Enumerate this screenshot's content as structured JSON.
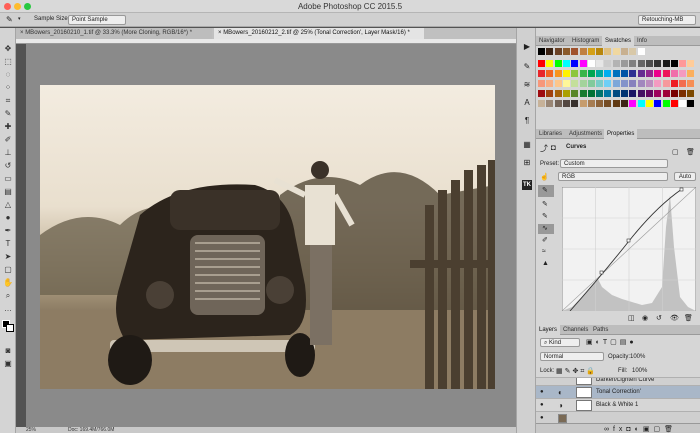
{
  "window": {
    "title": "Adobe Photoshop CC 2015.5"
  },
  "options_bar": {
    "sample_size_label": "Sample Size:",
    "sample_size_value": "Point Sample",
    "workspace": "Retouching-MB"
  },
  "documents": [
    {
      "label": "MBowers_20160210_1.tif @ 33.3% (More Cloning, RGB/16*) *",
      "active": false
    },
    {
      "label": "MBowers_20160212_2.tif @ 25% (Tonal Correction', Layer Mask/16) *",
      "active": true
    }
  ],
  "status_bar": {
    "zoom": "25%",
    "doc": "Doc: 169.4M/766.0M"
  },
  "top_panel": {
    "tabs": [
      "Navigator",
      "Histogram",
      "Swatches",
      "Info"
    ],
    "active_tab": "Swatches",
    "swatch_rows": [
      [
        "#000000",
        "#3b2314",
        "#6b4226",
        "#8b5a2b",
        "#a0522d",
        "#c08040",
        "#d4a017",
        "#b8860b",
        "#e0c080",
        "#f0d8a0",
        "#c8b090",
        "#d8c8a8",
        "#ffffff"
      ],
      [
        "#ff0000",
        "#ffff00",
        "#00ff00",
        "#00ffff",
        "#0000ff",
        "#ff00ff",
        "#ffffff",
        "#e6e6e6",
        "#cccccc",
        "#b3b3b3",
        "#999999",
        "#808080",
        "#666666",
        "#4d4d4d",
        "#333333",
        "#1a1a1a",
        "#000000",
        "#ff9999",
        "#ffcc99"
      ],
      [
        "#e8262a",
        "#f26522",
        "#f7941d",
        "#fff200",
        "#8dc63f",
        "#39b54a",
        "#00a651",
        "#00a99d",
        "#00aeef",
        "#0072bc",
        "#0054a6",
        "#2e3192",
        "#662d91",
        "#92278f",
        "#ec008c",
        "#ed145b",
        "#f06eaa",
        "#f49ac1",
        "#fbaf5d"
      ],
      [
        "#f7977a",
        "#f9ad81",
        "#fdc68a",
        "#fff79a",
        "#c4df9b",
        "#a3d39c",
        "#82ca9c",
        "#7accc8",
        "#6dcff6",
        "#7da7d9",
        "#8393ca",
        "#8781bd",
        "#a187be",
        "#bc8dbf",
        "#f49ac1",
        "#f6989d",
        "#ed1c24",
        "#f26c4f",
        "#f68e55"
      ],
      [
        "#9e0b0f",
        "#a0410d",
        "#a3620a",
        "#aba000",
        "#598527",
        "#197b30",
        "#007236",
        "#00746b",
        "#0076a3",
        "#004a80",
        "#003471",
        "#1b1464",
        "#440e62",
        "#630460",
        "#9e005d",
        "#9e0039",
        "#790000",
        "#7b2e00",
        "#7d4900"
      ],
      [
        "#c7b299",
        "#998675",
        "#736357",
        "#534741",
        "#37302d",
        "#c69c6d",
        "#a67c52",
        "#8c6239",
        "#754c24",
        "#603913",
        "#3c2415",
        "#ff00ff",
        "#00ffff",
        "#ffff00",
        "#0000ff",
        "#00ff00",
        "#ff0000",
        "#ffffff",
        "#000000"
      ]
    ]
  },
  "properties_panel": {
    "tabs": [
      "Libraries",
      "Adjustments",
      "Properties"
    ],
    "active_tab": "Properties",
    "adjustment": "Curves",
    "preset_label": "Preset:",
    "preset_value": "Custom",
    "channel": "RGB",
    "auto_button": "Auto"
  },
  "layers_panel": {
    "tabs": [
      "Layers",
      "Channels",
      "Paths"
    ],
    "active_tab": "Layers",
    "filter_kind": "Kind",
    "blend_mode": "Normal",
    "opacity_label": "Opacity:",
    "opacity_value": "100%",
    "lock_label": "Lock:",
    "fill_label": "Fill:",
    "fill_value": "100%",
    "layers": [
      {
        "name": "Darken/Lighten Curve",
        "selected": false
      },
      {
        "name": "Tonal Correction'",
        "selected": true
      },
      {
        "name": "Black & White 1",
        "selected": false
      }
    ]
  },
  "colors": {
    "accent": "#2b6cd6",
    "selection": "#a9b7c8"
  }
}
